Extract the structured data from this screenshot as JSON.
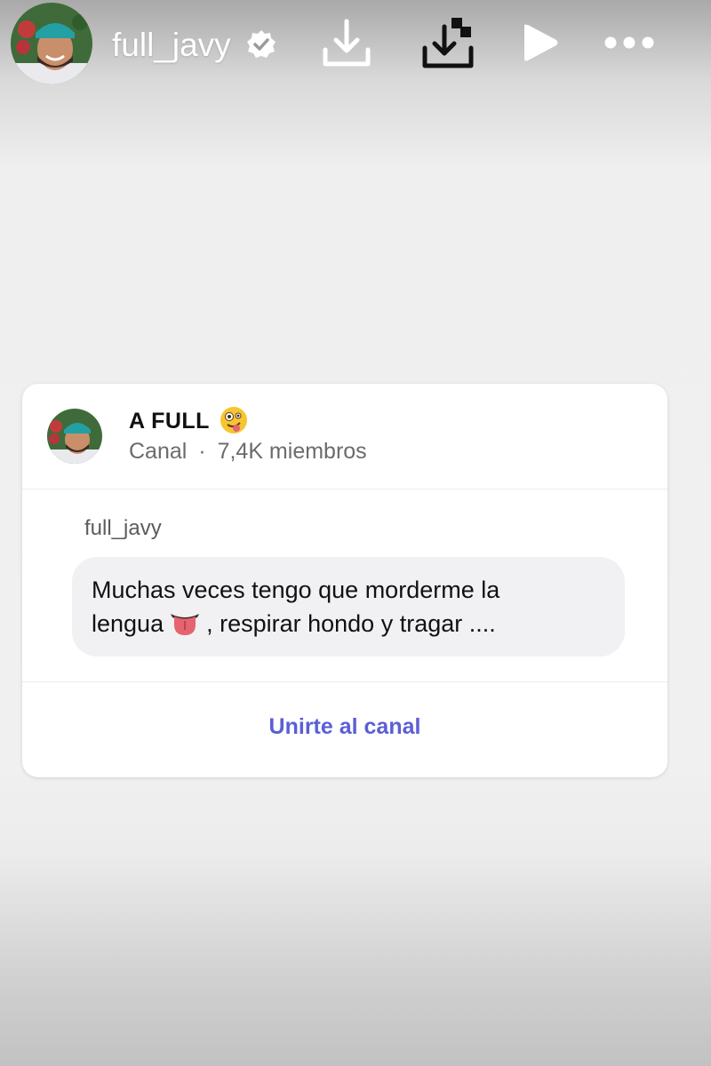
{
  "header": {
    "username": "full_javy",
    "icons": [
      "avatar",
      "verified-badge-icon",
      "download-icon",
      "save-to-device-icon",
      "play-icon",
      "more-options-icon"
    ]
  },
  "card": {
    "channel_name": "A FULL",
    "channel_type": "Canal",
    "separator": "·",
    "members": "7,4K miembros",
    "author": "full_javy",
    "message_line1": "Muchas veces tengo que morderme la",
    "message_line2_before": "lengua",
    "message_line2_after": ", respirar hondo y tragar ....",
    "join_label": "Unirte al canal"
  },
  "colors": {
    "accent": "#5a5fd6",
    "bubble": "#f1f1f3"
  }
}
